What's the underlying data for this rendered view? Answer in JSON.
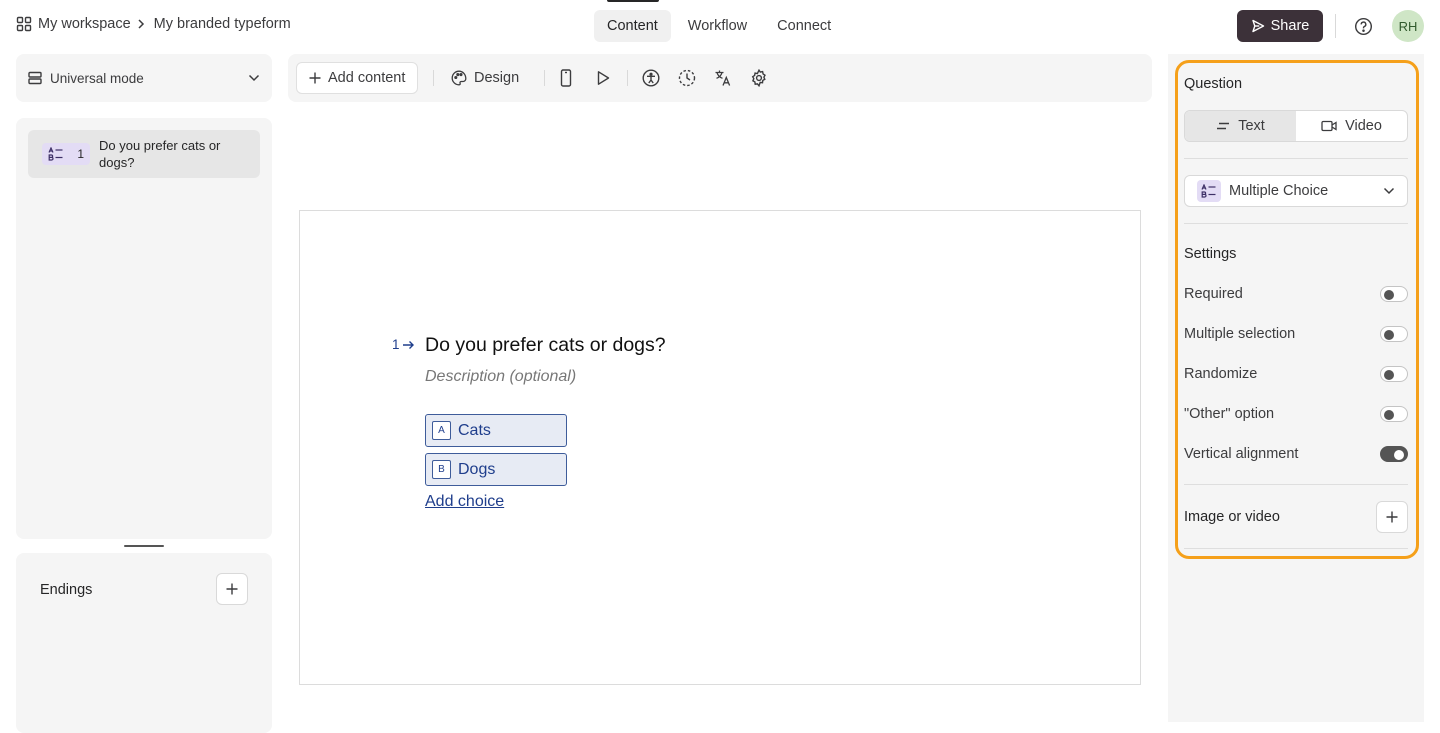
{
  "header": {
    "workspace": "My workspace",
    "form_name": "My branded typeform",
    "tabs": [
      {
        "label": "Content",
        "active": true
      },
      {
        "label": "Workflow",
        "active": false
      },
      {
        "label": "Connect",
        "active": false
      }
    ],
    "share_label": "Share",
    "avatar_initials": "RH"
  },
  "left": {
    "mode_label": "Universal mode",
    "questions": [
      {
        "number": "1",
        "text": "Do you prefer cats or dogs?"
      }
    ],
    "endings_label": "Endings"
  },
  "toolbar": {
    "add_content_label": "Add content",
    "design_label": "Design",
    "icons": [
      "mobile-preview-icon",
      "play-icon",
      "accessibility-icon",
      "logic-icon",
      "translate-icon",
      "settings-icon"
    ]
  },
  "canvas": {
    "question_number": "1",
    "question_title": "Do you prefer cats or dogs?",
    "description_placeholder": "Description (optional)",
    "choices": [
      {
        "key": "A",
        "label": "Cats"
      },
      {
        "key": "B",
        "label": "Dogs"
      }
    ],
    "add_choice_label": "Add choice"
  },
  "panel": {
    "question_heading": "Question",
    "format_options": [
      {
        "label": "Text",
        "active": true
      },
      {
        "label": "Video",
        "active": false
      }
    ],
    "question_type": "Multiple Choice",
    "settings_heading": "Settings",
    "settings": [
      {
        "label": "Required",
        "on": false
      },
      {
        "label": "Multiple selection",
        "on": false
      },
      {
        "label": "Randomize",
        "on": false
      },
      {
        "label": "\"Other\" option",
        "on": false
      },
      {
        "label": "Vertical alignment",
        "on": true
      }
    ],
    "media_label": "Image or video"
  },
  "colors": {
    "highlight_border": "#f5a01a",
    "share_button": "#3c3139",
    "choice_accent": "#1f3e8c",
    "type_badge": "#e3dcf5",
    "avatar": "#cfe6c6"
  }
}
